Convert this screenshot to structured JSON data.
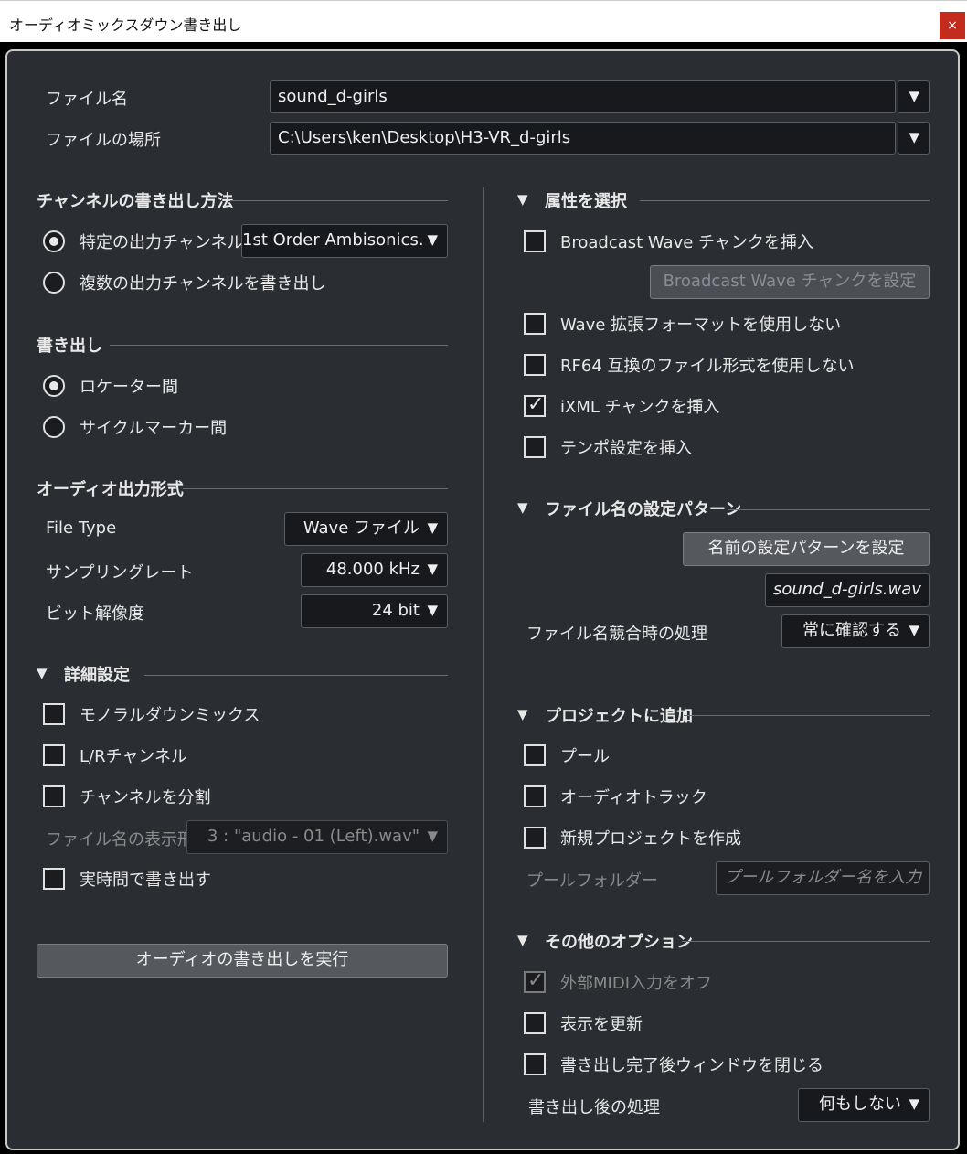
{
  "window": {
    "title": "オーディオミックスダウン書き出し",
    "close_label": "×"
  },
  "file": {
    "name_label": "ファイル名",
    "name_value": "sound_d-girls",
    "location_label": "ファイルの場所",
    "location_value": "C:\\Users\\ken\\Desktop\\H3-VR_d-girls"
  },
  "channel": {
    "title": "チャンネルの書き出し方法",
    "opt1": "特定の出力チャンネル",
    "opt1_value": "1st Order Ambisonics.",
    "opt2": "複数の出力チャンネルを書き出し"
  },
  "export": {
    "title": "書き出し",
    "opt1": "ロケーター間",
    "opt2": "サイクルマーカー間"
  },
  "format": {
    "title": "オーディオ出力形式",
    "filetype_label": "File Type",
    "filetype_value": "Wave ファイル",
    "rate_label": "サンプリングレート",
    "rate_value": "48.000 kHz",
    "bit_label": "ビット解像度",
    "bit_value": "24 bit"
  },
  "detail": {
    "title": "詳細設定",
    "mono": "モノラルダウンミックス",
    "lr": "L/Rチャンネル",
    "split": "チャンネルを分割",
    "display_label": "ファイル名の表示形.",
    "display_value": "3 : \"audio - 01 (Left).wav\"",
    "realtime": "実時間で書き出す"
  },
  "run_button": "オーディオの書き出しを実行",
  "attrs": {
    "title": "属性を選択",
    "bwf": "Broadcast Wave チャンクを挿入",
    "bwf_button": "Broadcast Wave チャンクを設定",
    "wave_ext": "Wave 拡張フォーマットを使用しない",
    "rf64": "RF64 互換のファイル形式を使用しない",
    "ixml": "iXML チャンクを挿入",
    "tempo": "テンポ設定を挿入"
  },
  "naming": {
    "title": "ファイル名の設定パターン",
    "button": "名前の設定パターンを設定",
    "preview": "sound_d-girls.wav",
    "conflict_label": "ファイル名競合時の処理",
    "conflict_value": "常に確認する"
  },
  "project": {
    "title": "プロジェクトに追加",
    "pool": "プール",
    "track": "オーディオトラック",
    "new_project": "新規プロジェクトを作成",
    "pool_folder_label": "プールフォルダー",
    "pool_folder_placeholder": "プールフォルダー名を入力"
  },
  "other": {
    "title": "その他のオプション",
    "midi_off": "外部MIDI入力をオフ",
    "refresh": "表示を更新",
    "close_after": "書き出し完了後ウィンドウを閉じる",
    "post_label": "書き出し後の処理",
    "post_value": "何もしない"
  },
  "dropdown_arrow": "▼"
}
